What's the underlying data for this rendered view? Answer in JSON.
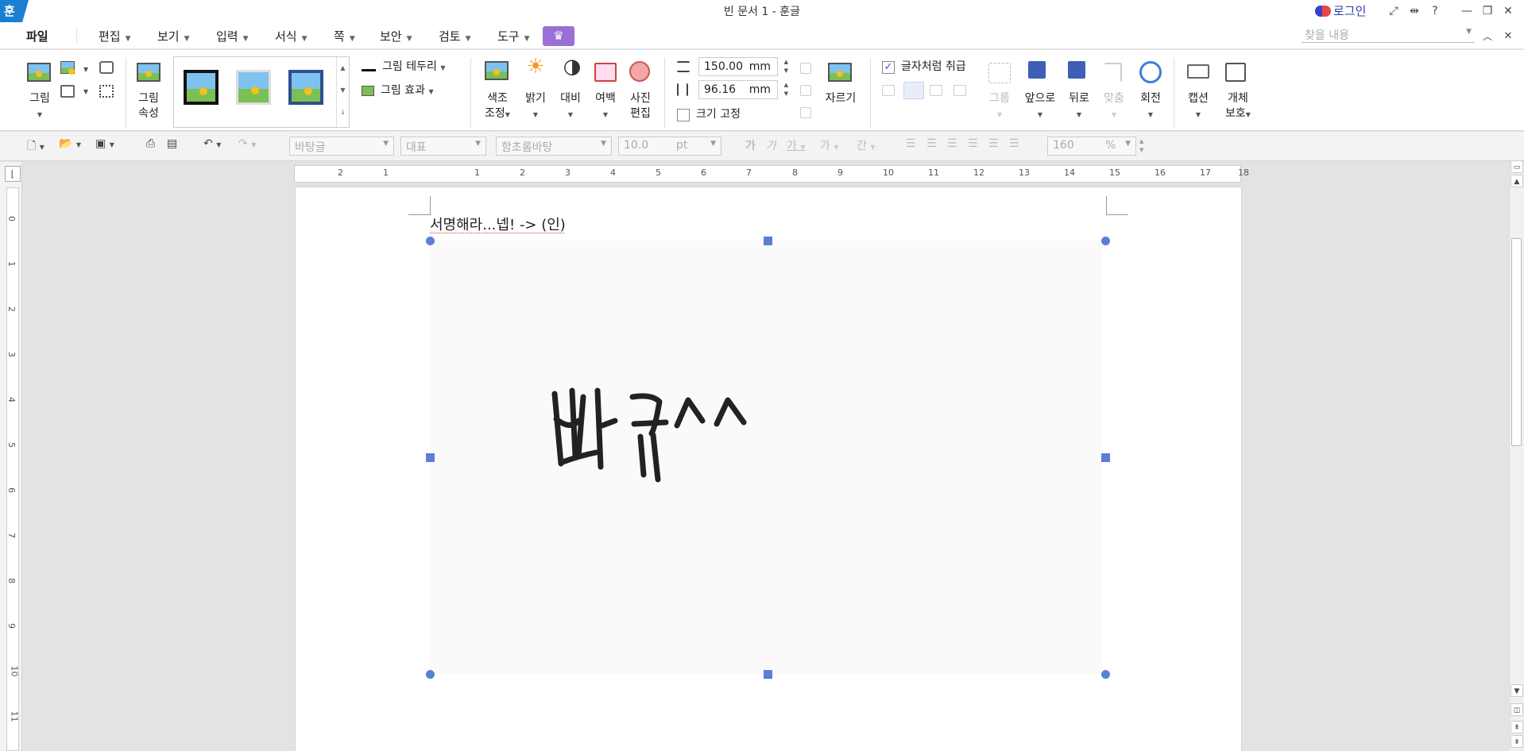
{
  "app": {
    "logo": "훈",
    "title": "빈 문서 1 - 훈글",
    "login": "로그인"
  },
  "menu": {
    "file": "파일",
    "items": [
      "편집",
      "보기",
      "입력",
      "서식",
      "쪽",
      "보안",
      "검토",
      "도구"
    ],
    "search_placeholder": "찾을 내용"
  },
  "ribbon": {
    "picture": "그림",
    "picture_props_1": "그림",
    "picture_props_2": "속성",
    "border": "그림 테두리",
    "effect": "그림 효과",
    "color_1": "색조",
    "color_2": "조정",
    "brightness": "밝기",
    "contrast": "대비",
    "margin": "여백",
    "photo_1": "사진",
    "photo_2": "편집",
    "width_value": "150.00",
    "height_value": "96.16",
    "unit": "mm",
    "size_fix": "크기 고정",
    "crop": "자르기",
    "treat_as_char": "글자처럼 취급",
    "group": "그룹",
    "front": "앞으로",
    "back": "뒤로",
    "align": "맞춤",
    "rotate": "회전",
    "caption": "캡션",
    "protect_1": "개체",
    "protect_2": "보호"
  },
  "toolbar2": {
    "style": "바탕글",
    "lang": "대표",
    "font": "함초롬바탕",
    "size": "10.0",
    "size_unit": "pt",
    "zoom": "160",
    "zoom_unit": "%"
  },
  "ruler": {
    "h_labels": [
      "2",
      "1",
      "1",
      "2",
      "3",
      "4",
      "5",
      "6",
      "7",
      "8",
      "9",
      "10",
      "11",
      "12",
      "13",
      "14",
      "15",
      "16",
      "17",
      "18"
    ],
    "v_labels": [
      "0",
      "1",
      "2",
      "3",
      "4",
      "5",
      "6",
      "7",
      "8",
      "9",
      "10",
      "11"
    ]
  },
  "document": {
    "text": "서명해라...넵!  -> (인)",
    "signature_text": "빠큐^^"
  },
  "colors": {
    "accent": "#1a7fd0",
    "handle": "#5b7fd6",
    "addon": "#9a70d6"
  }
}
